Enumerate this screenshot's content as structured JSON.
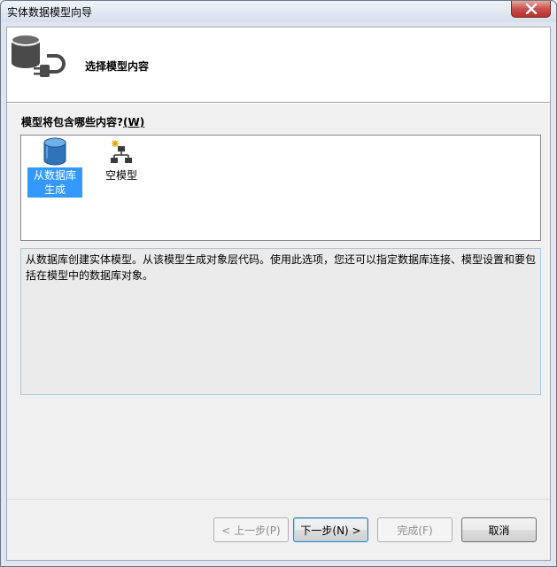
{
  "window": {
    "title": "实体数据模型向导"
  },
  "header": {
    "title": "选择模型内容",
    "icon": "database-plug-icon"
  },
  "prompt": {
    "text": "模型将包含哪些内容?",
    "accelerator": "(W)",
    "accelerator_key": "W"
  },
  "options": [
    {
      "label": "从数据库生成",
      "icon": "database-icon",
      "selected": true
    },
    {
      "label": "空模型",
      "icon": "empty-model-icon",
      "selected": false
    }
  ],
  "description": "从数据库创建实体模型。从该模型生成对象层代码。使用此选项，您还可以指定数据库连接、模型设置和要包括在模型中的数据库对象。",
  "buttons": {
    "back": {
      "label": "< 上一步(P)",
      "enabled": false
    },
    "next": {
      "label": "下一步(N) >",
      "enabled": true,
      "default": true
    },
    "finish": {
      "label": "完成(F)",
      "enabled": false
    },
    "cancel": {
      "label": "取消",
      "enabled": true
    }
  },
  "colors": {
    "selection": "#3399ff",
    "close_button": "#c75050",
    "database_icon": "#2f73b8"
  }
}
